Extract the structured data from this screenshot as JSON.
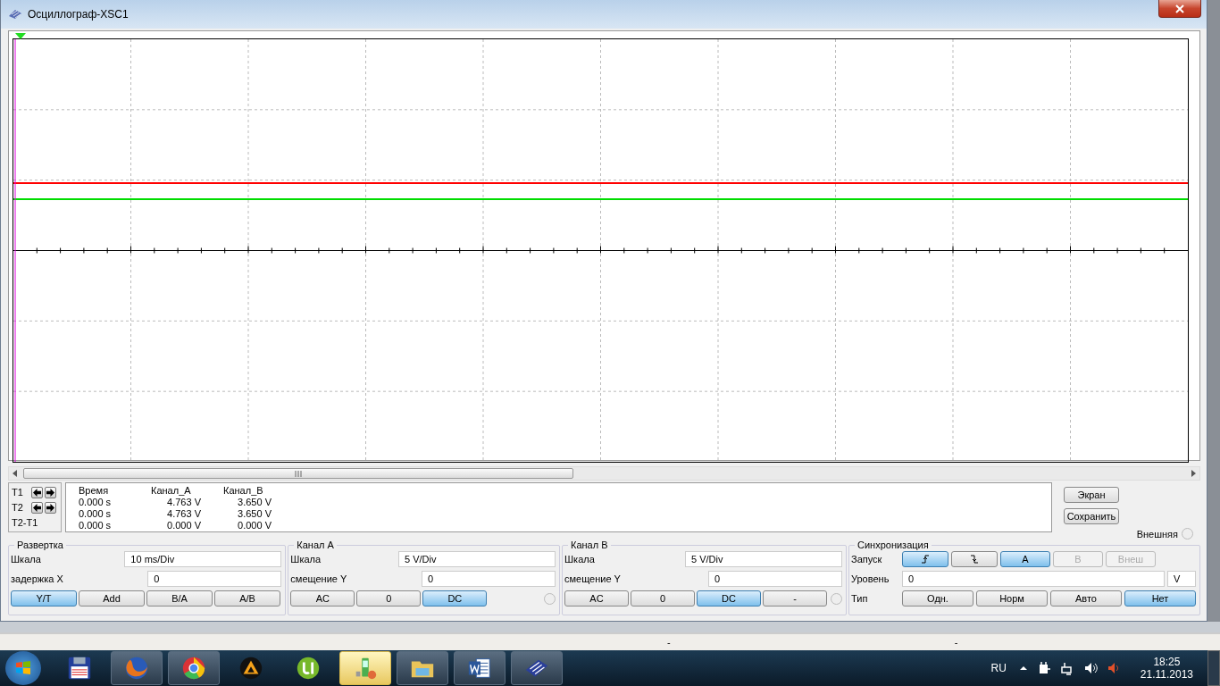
{
  "window": {
    "title": "Осциллограф-XSC1"
  },
  "traces": [
    {
      "color": "#ff0000"
    },
    {
      "color": "#00dd00"
    }
  ],
  "readout": {
    "headers": [
      "Время",
      "Канал_A",
      "Канал_B"
    ],
    "rows": [
      {
        "label": "T1",
        "kind": "cursor",
        "values": [
          "0.000 s",
          "4.763 V",
          "3.650 V"
        ]
      },
      {
        "label": "T2",
        "kind": "cursor",
        "values": [
          "0.000 s",
          "4.763 V",
          "3.650 V"
        ]
      },
      {
        "label": "T2-T1",
        "kind": "difference",
        "values": [
          "0.000 s",
          "0.000 V",
          "0.000 V"
        ]
      }
    ]
  },
  "side_buttons": [
    "Экран",
    "Сохранить"
  ],
  "external": {
    "label": "Внешняя",
    "selected": false
  },
  "timebase": {
    "title": "Развертка",
    "fields": [
      {
        "label": "Шкала",
        "value": "10 ms/Div"
      },
      {
        "label": "задержка X",
        "value": "0"
      }
    ],
    "modes": [
      {
        "label": "Y/T",
        "selected": true
      },
      {
        "label": "Add",
        "selected": false
      },
      {
        "label": "B/A",
        "selected": false
      },
      {
        "label": "A/B",
        "selected": false
      }
    ]
  },
  "channels": [
    {
      "title": "Канал A",
      "fields": [
        {
          "label": "Шкала",
          "value": "5  V/Div"
        },
        {
          "label": "смещение Y",
          "value": "0"
        }
      ],
      "coupling": [
        {
          "label": "AC",
          "selected": false
        },
        {
          "label": "0",
          "selected": false
        },
        {
          "label": "DC",
          "selected": true
        }
      ],
      "radio_selected": false
    },
    {
      "title": "Канал B",
      "fields": [
        {
          "label": "Шкала",
          "value": "5  V/Div"
        },
        {
          "label": "смещение Y",
          "value": "0"
        }
      ],
      "coupling": [
        {
          "label": "AC",
          "selected": false
        },
        {
          "label": "0",
          "selected": false
        },
        {
          "label": "DC",
          "selected": true
        },
        {
          "label": "-",
          "selected": false
        }
      ],
      "radio_selected": false
    }
  ],
  "trigger": {
    "title": "Синхронизация",
    "edge_label": "Запуск",
    "edges": [
      {
        "kind": "rising",
        "selected": true
      },
      {
        "kind": "falling",
        "selected": false
      }
    ],
    "sources": [
      {
        "label": "A",
        "selected": true,
        "disabled": false
      },
      {
        "label": "B",
        "selected": false,
        "disabled": true
      },
      {
        "label": "Внеш",
        "selected": false,
        "disabled": true
      }
    ],
    "level": {
      "label": "Уровень",
      "value": "0",
      "unit": "V"
    },
    "type_label": "Тип",
    "types": [
      {
        "label": "Одн.",
        "selected": false
      },
      {
        "label": "Норм",
        "selected": false
      },
      {
        "label": "Авто",
        "selected": false
      },
      {
        "label": "Нет",
        "selected": true
      }
    ]
  },
  "status_bar": [
    "-",
    "-"
  ],
  "taskbar": {
    "apps": [
      {
        "kind": "floppy",
        "running": false,
        "selected": false
      },
      {
        "kind": "firefox",
        "running": true,
        "selected": false
      },
      {
        "kind": "chrome",
        "running": true,
        "selected": false
      },
      {
        "kind": "aimp",
        "running": false,
        "selected": false
      },
      {
        "kind": "utorrent",
        "running": false,
        "selected": false
      },
      {
        "kind": "phone",
        "running": true,
        "selected": true
      },
      {
        "kind": "folder",
        "running": true,
        "selected": false
      },
      {
        "kind": "word",
        "running": true,
        "selected": false
      },
      {
        "kind": "circuit",
        "running": true,
        "selected": false
      }
    ],
    "language": "RU",
    "time": "18:25",
    "date": "21.11.2013"
  }
}
